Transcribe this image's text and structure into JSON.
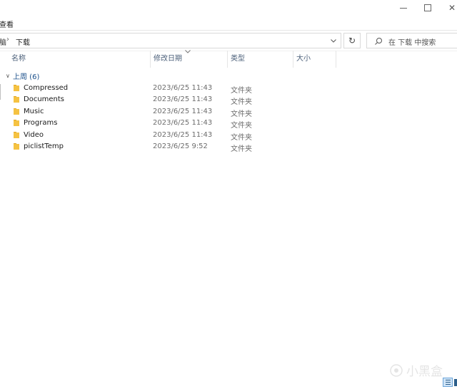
{
  "ribbon": {
    "tab_label": "查看"
  },
  "address": {
    "prev_crumb": "脑",
    "current_folder": "下载"
  },
  "search": {
    "placeholder": "在 下载 中搜索"
  },
  "columns": {
    "name": "名称",
    "date_modified": "修改日期",
    "type": "类型",
    "size": "大小"
  },
  "group": {
    "label": "上周 (6)"
  },
  "files": [
    {
      "name": "Compressed",
      "date": "2023/6/25 11:43",
      "type": "文件夹"
    },
    {
      "name": "Documents",
      "date": "2023/6/25 11:43",
      "type": "文件夹"
    },
    {
      "name": "Music",
      "date": "2023/6/25 11:43",
      "type": "文件夹"
    },
    {
      "name": "Programs",
      "date": "2023/6/25 11:43",
      "type": "文件夹"
    },
    {
      "name": "Video",
      "date": "2023/6/25 11:43",
      "type": "文件夹"
    },
    {
      "name": "piclistTemp",
      "date": "2023/6/25 9:52",
      "type": "文件夹"
    }
  ],
  "watermark": {
    "text": "小黑盒"
  },
  "colors": {
    "folder": "#f5c242",
    "folder_dark": "#e3a823",
    "group_text": "#1a4f8a",
    "header_text": "#4c607a"
  },
  "icons": {
    "folder": "folder-icon",
    "search": "search-icon",
    "refresh": "refresh-icon",
    "chevron": "chevron-down-icon"
  }
}
